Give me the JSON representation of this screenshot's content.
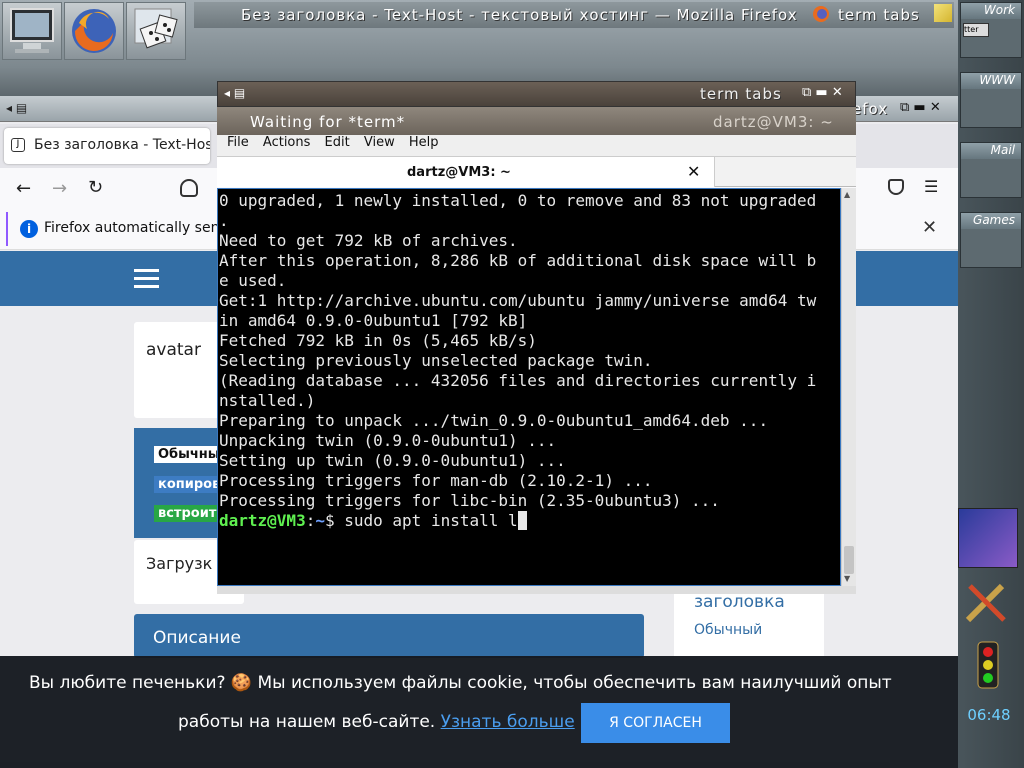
{
  "topbar": {
    "window_title": "Без заголовка - Text-Host - текстовый хостинг — Mozilla Firefox",
    "right_title": "term tabs",
    "launchers": [
      "monitor-icon",
      "firefox-icon",
      "dice-icon"
    ]
  },
  "dock": {
    "workspaces": [
      "Work",
      "WWW",
      "Mail",
      "Games"
    ],
    "mini_label": "tter",
    "clock": "06:48"
  },
  "firefox": {
    "tab_label": "Без заголовка - Text-Host",
    "right_title": "efox",
    "notice": "Firefox automatically sends",
    "page": {
      "avatar_label": "avatar",
      "tags": [
        "Обычный",
        "копиров",
        "встроит"
      ],
      "upload_label": "Загрузк",
      "description_heading": "Описание",
      "side_heading": "заголовка",
      "side_item": "Обычный"
    },
    "cookie": {
      "text1": "Вы любите печеньки? 🍪 Мы используем файлы cookie, чтобы обеспечить вам наилучший опыт",
      "text2": "работы на нашем веб-сайте.",
      "link": "Узнать больше",
      "agree": "Я СОГЛАСЕН"
    }
  },
  "terminal": {
    "title": "term tabs",
    "tab_label": "Waiting for *term*",
    "tab_right": "dartz@VM3: ~",
    "menu": [
      "File",
      "Actions",
      "Edit",
      "View",
      "Help"
    ],
    "header_title": "dartz@VM3: ~",
    "lines": [
      "0 upgraded, 1 newly installed, 0 to remove and 83 not upgraded",
      ".",
      "Need to get 792 kB of archives.",
      "After this operation, 8,286 kB of additional disk space will b",
      "e used.",
      "Get:1 http://archive.ubuntu.com/ubuntu jammy/universe amd64 tw",
      "in amd64 0.9.0-0ubuntu1 [792 kB]",
      "Fetched 792 kB in 0s (5,465 kB/s)",
      "Selecting previously unselected package twin.",
      "(Reading database ... 432056 files and directories currently i",
      "nstalled.)",
      "Preparing to unpack .../twin_0.9.0-0ubuntu1_amd64.deb ...",
      "Unpacking twin (0.9.0-0ubuntu1) ...",
      "Setting up twin (0.9.0-0ubuntu1) ...",
      "Processing triggers for man-db (2.10.2-1) ...",
      "Processing triggers for libc-bin (2.35-0ubuntu3) ..."
    ],
    "prompt_user": "dartz@VM3",
    "prompt_sep": ":",
    "prompt_path": "~",
    "prompt_dollar": "$ ",
    "command": "sudo apt install l"
  }
}
